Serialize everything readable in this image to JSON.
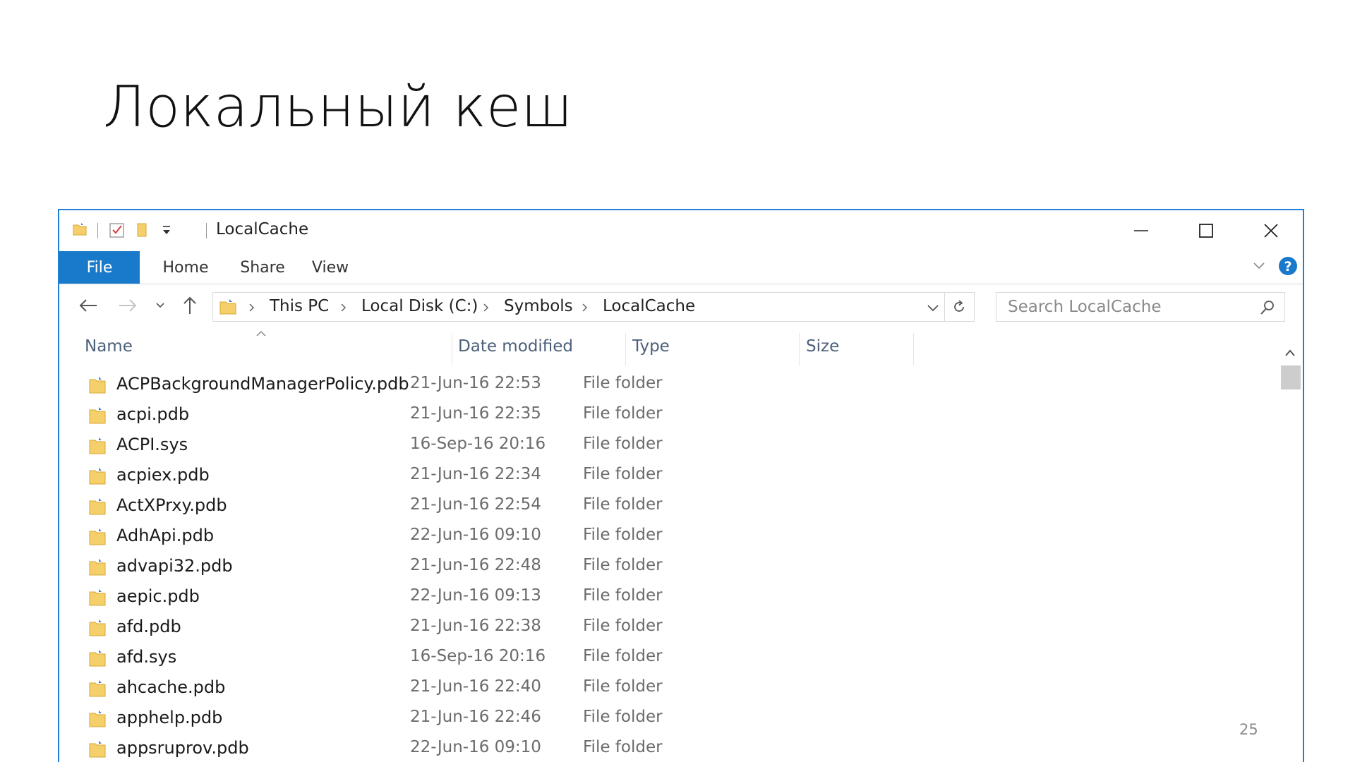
{
  "slide": {
    "title": "Локальный кеш",
    "page_number": "25"
  },
  "window": {
    "title": "LocalCache",
    "accent": "#1979ca"
  },
  "ribbon": {
    "tabs": [
      "File",
      "Home",
      "Share",
      "View"
    ]
  },
  "address": {
    "crumbs": [
      "This PC",
      "Local Disk (C:)",
      "Symbols",
      "LocalCache"
    ]
  },
  "search": {
    "placeholder": "Search LocalCache"
  },
  "columns": {
    "name": "Name",
    "date": "Date modified",
    "type": "Type",
    "size": "Size"
  },
  "files": [
    {
      "name": "ACPBackgroundManagerPolicy.pdb",
      "date": "21-Jun-16 22:53",
      "type": "File folder"
    },
    {
      "name": "acpi.pdb",
      "date": "21-Jun-16 22:35",
      "type": "File folder"
    },
    {
      "name": "ACPI.sys",
      "date": "16-Sep-16 20:16",
      "type": "File folder"
    },
    {
      "name": "acpiex.pdb",
      "date": "21-Jun-16 22:34",
      "type": "File folder"
    },
    {
      "name": "ActXPrxy.pdb",
      "date": "21-Jun-16 22:54",
      "type": "File folder"
    },
    {
      "name": "AdhApi.pdb",
      "date": "22-Jun-16 09:10",
      "type": "File folder"
    },
    {
      "name": "advapi32.pdb",
      "date": "21-Jun-16 22:48",
      "type": "File folder"
    },
    {
      "name": "aepic.pdb",
      "date": "22-Jun-16 09:13",
      "type": "File folder"
    },
    {
      "name": "afd.pdb",
      "date": "21-Jun-16 22:38",
      "type": "File folder"
    },
    {
      "name": "afd.sys",
      "date": "16-Sep-16 20:16",
      "type": "File folder"
    },
    {
      "name": "ahcache.pdb",
      "date": "21-Jun-16 22:40",
      "type": "File folder"
    },
    {
      "name": "apphelp.pdb",
      "date": "21-Jun-16 22:46",
      "type": "File folder"
    },
    {
      "name": "appsruprov.pdb",
      "date": "22-Jun-16 09:10",
      "type": "File folder"
    }
  ]
}
